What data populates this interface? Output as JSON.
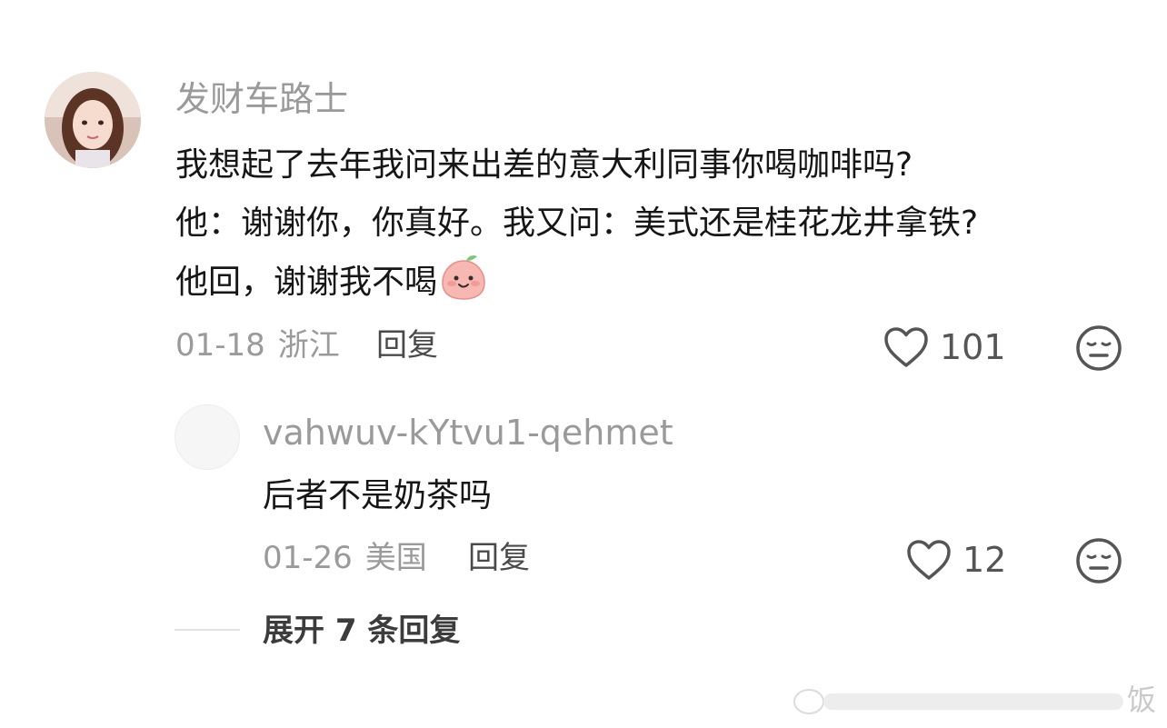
{
  "comment": {
    "username": "发财车路士",
    "lines": [
      "我想起了去年我问来出差的意大利同事你喝咖啡吗?",
      "他：谢谢你，你真好。我又问：美式还是桂花龙井拿铁?",
      "他回，谢谢我不喝"
    ],
    "emoji_icon": "peach-smile-emoji",
    "date": "01-18",
    "location": "浙江",
    "reply_label": "回复",
    "like_count": "101",
    "like_icon": "heart-outline-icon",
    "dislike_icon": "neutral-face-icon"
  },
  "reply": {
    "username": "vahwuv-kYtvu1-qehmet",
    "text": "后者不是奶茶吗",
    "date": "01-26",
    "location": "美国",
    "reply_label": "回复",
    "like_count": "12"
  },
  "expand": {
    "label": "展开 7 条回复"
  },
  "watermark": {
    "text": "饭"
  },
  "colors": {
    "secondary_text": "#9a9a9a",
    "primary_text": "#161616",
    "icon_stroke": "#555555",
    "emoji_pink": "#f7b7b3"
  }
}
